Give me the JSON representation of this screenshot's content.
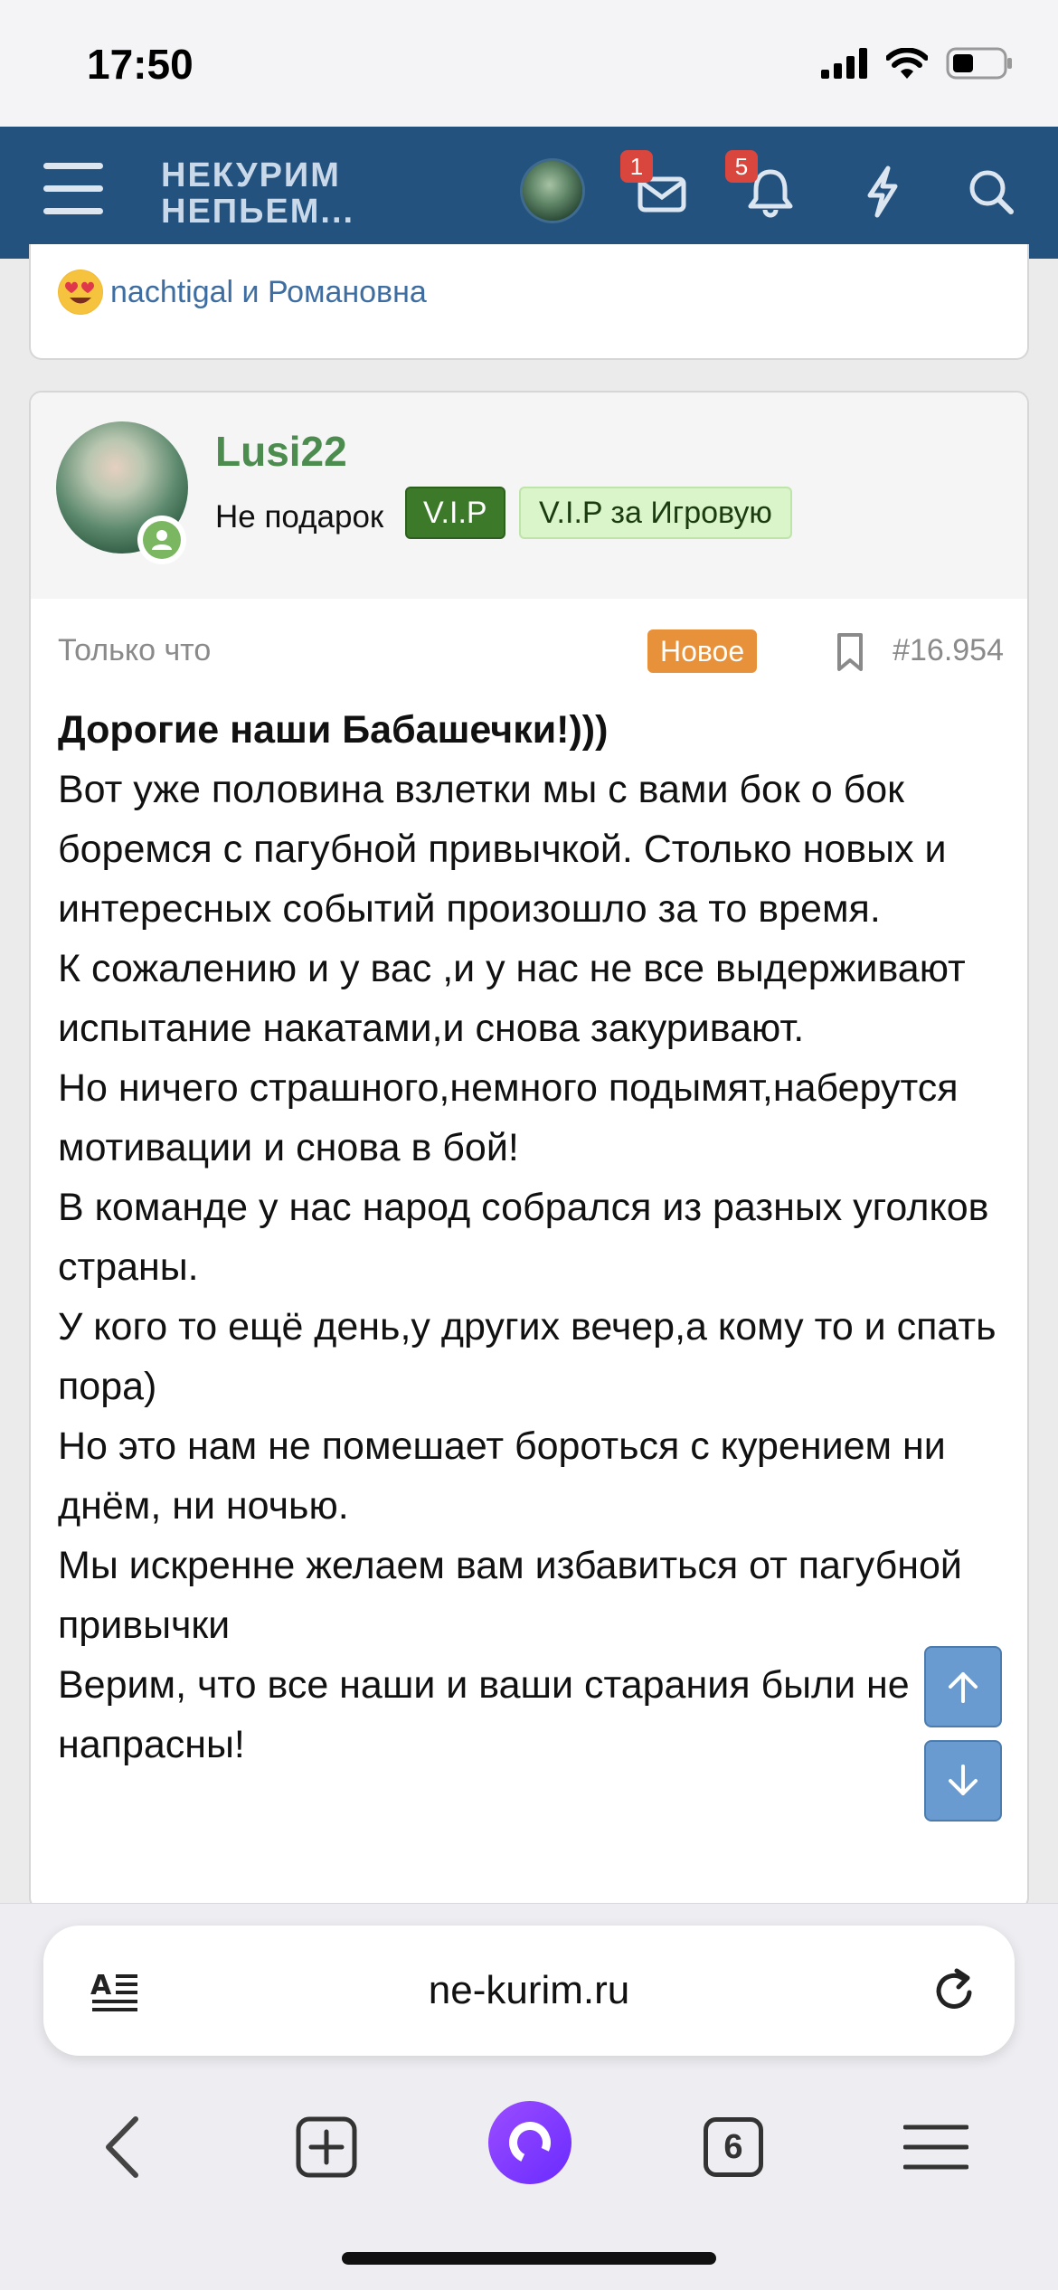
{
  "status_bar": {
    "time": "17:50"
  },
  "header": {
    "logo_line1": "НЕКУРИМ",
    "logo_line2": "НЕПЬЕМ...",
    "messages_badge": "1",
    "alerts_badge": "5",
    "colors": {
      "header_bg": "#24527e",
      "badge": "#d9463d"
    }
  },
  "reactions": {
    "text": "nachtigal и Романовна"
  },
  "post": {
    "author": "Lusi22",
    "user_title": "Не подарок",
    "banners": [
      "V.I.P",
      "V.I.P за Игровую"
    ],
    "time": "Только что",
    "new_label": "Новое",
    "post_number": "#16.954",
    "body": [
      {
        "text": "Дорогие наши Бабашечки!)))",
        "bold": true
      },
      {
        "text": "Вот уже половина взлетки мы с вами бок о бок боремся с пагубной привычкой. Столько новых и интересных событий произошло за то время."
      },
      {
        "text": "К сожалению и у вас ,и у нас не все выдерживают испытание накатами,и снова закуривают."
      },
      {
        "text": "Но ничего страшного,немного подымят,наберутся мотивации и снова в бой!"
      },
      {
        "text": "В команде у нас народ собрался из разных уголков страны."
      },
      {
        "text": "У кого то ещё день,у других вечер,а кому то и спать пора)"
      },
      {
        "text": "Но это нам не помешает бороться с курением ни днём, ни ночью."
      },
      {
        "text": "Мы искренне желаем вам избавиться от пагубной привычки"
      },
      {
        "text": "Верим, что все наши и ваши старания были не напрасны!"
      }
    ],
    "colors": {
      "author": "#4c8c4f",
      "new_badge": "#e7913a",
      "vip": "#3c7a29",
      "vip2": "#d9f5c9"
    }
  },
  "browser": {
    "url": "ne-kurim.ru",
    "tabs_count": "6"
  }
}
